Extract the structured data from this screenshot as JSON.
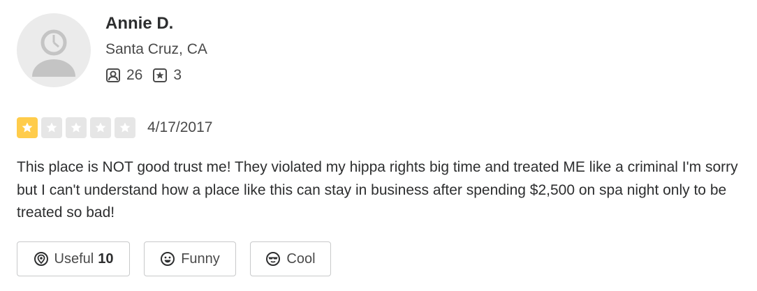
{
  "reviewer": {
    "name": "Annie D.",
    "location": "Santa Cruz, CA",
    "friends_count": "26",
    "reviews_count": "3"
  },
  "review": {
    "rating": 1,
    "rating_max": 5,
    "date": "4/17/2017",
    "text": "This place is NOT good trust me! They violated my hippa rights big time and treated ME like a criminal I'm sorry but I can't understand how a place like this can stay in business after spending $2,500 on spa night only to be treated so bad!"
  },
  "actions": {
    "useful_label": "Useful",
    "useful_count": "10",
    "funny_label": "Funny",
    "cool_label": "Cool"
  },
  "colors": {
    "star_filled": "#ffcc4b",
    "star_empty": "#e6e6e6",
    "text": "#2d2e2f"
  },
  "icons": {
    "avatar": "default-user-avatar",
    "friends": "friends-icon",
    "reviews": "review-star-icon",
    "useful": "lightbulb-icon",
    "funny": "smiley-icon",
    "cool": "sunglasses-icon"
  }
}
